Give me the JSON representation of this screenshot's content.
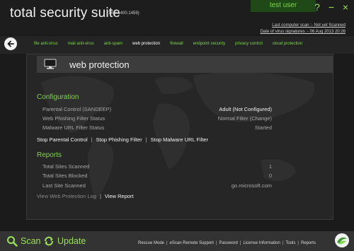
{
  "app": {
    "title": "total security suite",
    "version": "(14.0.1400.1459)",
    "user": "test user",
    "last_scan": "Last computer scan :- Not yet Scanned",
    "virus_sig": "Date of  virus signatures :- 06 Aug 2013 20:26"
  },
  "window_controls": {
    "help": "?",
    "minimize": "−",
    "close": "×"
  },
  "nav": {
    "tabs": [
      "file anti-virus",
      "mail anti-virus",
      "anti-spam",
      "web protection",
      "firewall",
      "endpoint security",
      "privacy control",
      "cloud protection"
    ],
    "active": "web protection"
  },
  "page": {
    "title": "web protection"
  },
  "configuration": {
    "title": "Configuration",
    "rows": [
      {
        "label": "Parental Control (SANDEEP)",
        "value": "Adult (Not Configured)"
      },
      {
        "label": "Web Phishing Filter Status",
        "value": "Normal Filter (Change)"
      },
      {
        "label": "Malware URL Filter Status",
        "value": "Started"
      }
    ],
    "actions": [
      "Stop Parental Control",
      "Stop Phishing Filter",
      "Stop Malware URL Filter"
    ]
  },
  "reports": {
    "title": "Reports",
    "rows": [
      {
        "label": "Total Sites Scanned",
        "value": "1"
      },
      {
        "label": "Total Sites Blocked",
        "value": "0"
      },
      {
        "label": "Last Site Scanned",
        "value": "go.microsoft.com"
      }
    ],
    "actions": [
      "View Web Protection Log",
      "View Report"
    ]
  },
  "bottom": {
    "scan": "Scan",
    "update": "Update",
    "links": [
      "Rescue Mode",
      "eScan Remote Support",
      "Password",
      "License Information",
      "Tools",
      "Reports"
    ]
  },
  "colors": {
    "accent": "#7ed64a",
    "background": "#1b1b1b",
    "panel": "#262626"
  }
}
